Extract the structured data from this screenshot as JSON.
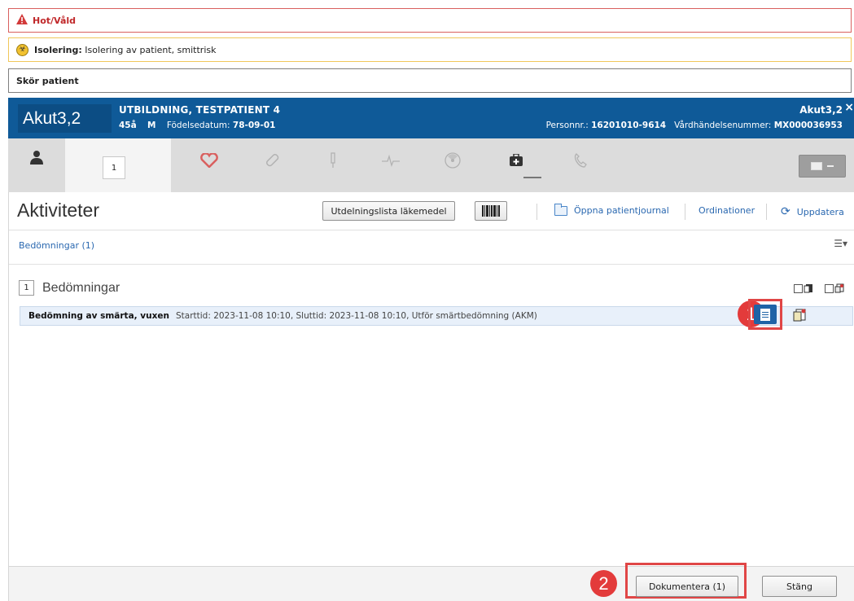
{
  "alerts": {
    "hot_label": "Hot/Våld",
    "iso_label": "Isolering:",
    "iso_text": "Isolering av patient, smittrisk",
    "skor_label": "Skör patient"
  },
  "patient": {
    "unit_box": "Akut3,2",
    "name": "UTBILDNING, TESTPATIENT 4",
    "age": "45å",
    "sex": "M",
    "dob_label": "Födelsedatum:",
    "dob": "78-09-01",
    "unit_right": "Akut3,2",
    "close": "×",
    "pnr_label": "Personnr.:",
    "pnr": "16201010-9614",
    "vhn_label": "Vårdhändelsenummer:",
    "vhn": "MX000036953"
  },
  "tabs": {
    "active_count": "1",
    "icons": [
      "person-icon",
      "heart-icon",
      "bandage-icon",
      "syringe-icon",
      "ecg-icon",
      "radiation-icon",
      "medkit-icon",
      "phone-icon"
    ]
  },
  "toolbar": {
    "title": "Aktiviteter",
    "utd_label": "Utdelningslista läkemedel",
    "open_journal": "Öppna patientjournal",
    "ordinationer": "Ordinationer",
    "uppdatera": "Uppdatera"
  },
  "filter": {
    "link": "Bedömningar (1)",
    "menu": "☰▾"
  },
  "group": {
    "count": "1",
    "label": "Bedömningar"
  },
  "activity": {
    "title": "Bedömning av smärta, vuxen",
    "details": "Starttid: 2023-11-08 10:10, Sluttid: 2023-11-08 10:10, Utför smärtbedömning (AKM)"
  },
  "annotations": {
    "badge1": "1",
    "badge2": "2",
    "highlight_color": "#e04646"
  },
  "footer": {
    "dokumentera": "Dokumentera (1)",
    "stang": "Stäng"
  },
  "colors": {
    "header_bg": "#0f5a98",
    "link": "#2a68b0",
    "hot_border": "#d9605f",
    "iso_border": "#f0c75a"
  }
}
